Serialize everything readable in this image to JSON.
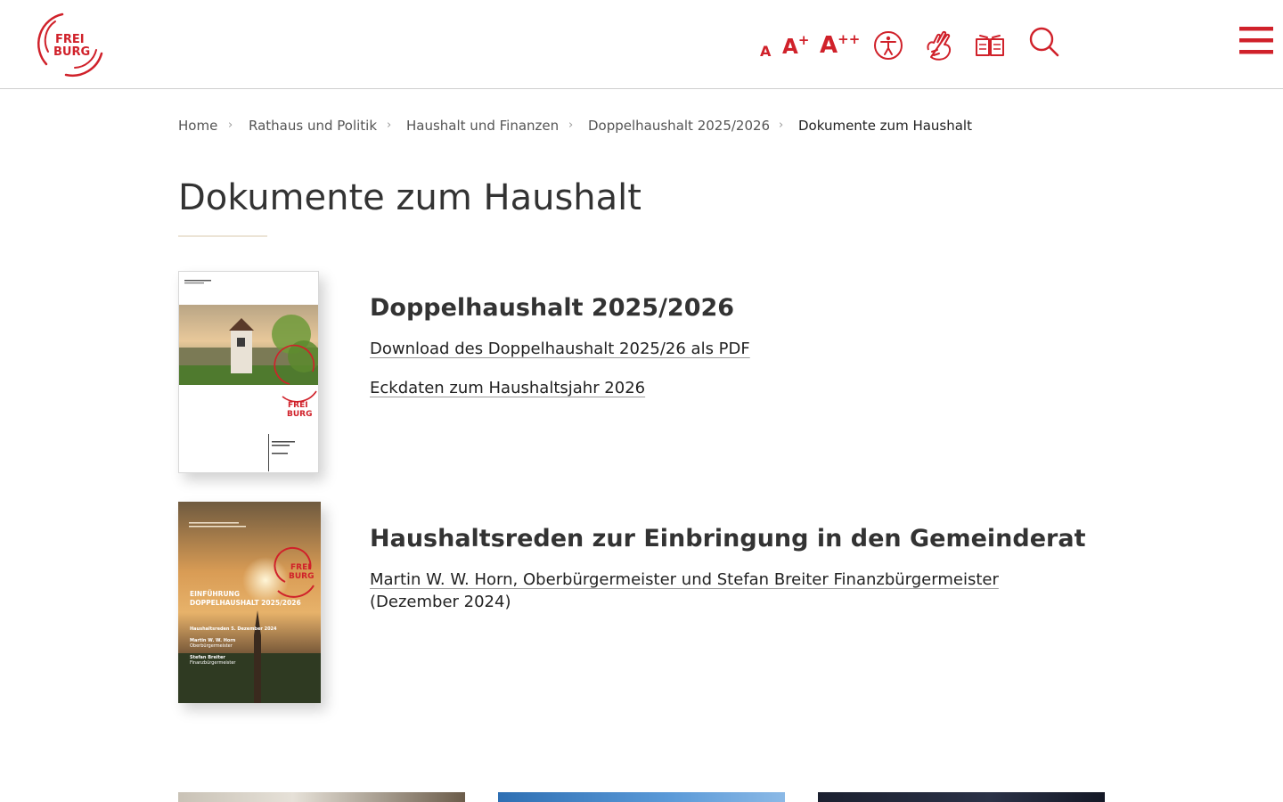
{
  "header": {
    "logo": {
      "line1": "FREI",
      "line2": "BURG"
    },
    "font_sizes": [
      {
        "base": "A",
        "sup": ""
      },
      {
        "base": "A",
        "sup": "+"
      },
      {
        "base": "A",
        "sup": "++"
      }
    ],
    "icons": [
      "accessibility-icon",
      "sign-language-icon",
      "easy-language-icon",
      "search-icon",
      "menu-icon"
    ]
  },
  "breadcrumb": {
    "items": [
      "Home",
      "Rathaus und Politik",
      "Haushalt und Finanzen",
      "Doppelhaushalt 2025/2026",
      "Dokumente zum Haushalt"
    ],
    "separator": "›"
  },
  "page": {
    "title": "Dokumente zum Haushalt"
  },
  "documents": [
    {
      "heading": "Doppelhaushalt 2025/2026",
      "links": [
        "Download des Doppelhaushalt 2025/26 als PDF",
        "Eckdaten zum Haushaltsjahr 2026"
      ],
      "thumbnail": {
        "logo_line1": "FREI",
        "logo_line2": "BURG"
      }
    },
    {
      "heading": "Haushaltsreden zur Einbringung in den Gemeinderat",
      "links": [
        "Martin W. W. Horn, Oberbürgermeister und Stefan Breiter Finanzbürgermeister"
      ],
      "note": "(Dezember 2024)",
      "thumbnail": {
        "logo_line1": "FREI",
        "logo_line2": "BURG",
        "title_line1": "EINFÜHRUNG",
        "title_line2": "DOPPELHAUSHALT 2025/2026",
        "subtitle": "Haushaltsreden 5. Dezember 2024",
        "speaker1_name": "Martin W. W. Horn",
        "speaker1_role": "Oberbürgermeister",
        "speaker2_name": "Stefan Breiter",
        "speaker2_role": "Finanzbürgermeister"
      }
    }
  ],
  "colors": {
    "brand_red": "#d0212a",
    "text": "#333333",
    "title_rule": "#ece4d6"
  }
}
